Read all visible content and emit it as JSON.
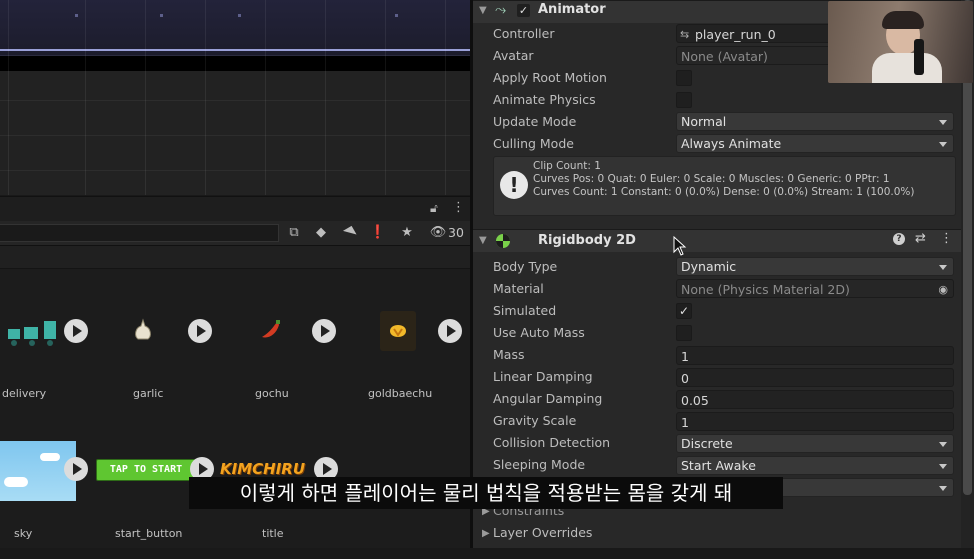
{
  "project": {
    "view_count": "30",
    "assets": [
      {
        "name": "delivery"
      },
      {
        "name": "garlic"
      },
      {
        "name": "gochu"
      },
      {
        "name": "goldbaechu"
      },
      {
        "name": "sky"
      },
      {
        "name": "start_button",
        "thumb_text": "TAP TO START"
      },
      {
        "name": "title",
        "thumb_text": "KIMCHIRU"
      }
    ]
  },
  "animator": {
    "title": "Animator",
    "enabled": true,
    "rows": {
      "controller_label": "Controller",
      "controller_value": "player_run_0",
      "avatar_label": "Avatar",
      "avatar_value": "None (Avatar)",
      "apply_root_motion_label": "Apply Root Motion",
      "animate_physics_label": "Animate Physics",
      "update_mode_label": "Update Mode",
      "update_mode_value": "Normal",
      "culling_mode_label": "Culling Mode",
      "culling_mode_value": "Always Animate"
    },
    "info": {
      "line1": "Clip Count: 1",
      "line2": "Curves Pos: 0 Quat: 0 Euler: 0 Scale: 0 Muscles: 0 Generic: 0 PPtr: 1",
      "line3": "Curves Count: 1 Constant: 0 (0.0%) Dense: 0 (0.0%) Stream: 1 (100.0%)"
    }
  },
  "rigidbody": {
    "title": "Rigidbody 2D",
    "rows": {
      "body_type_label": "Body Type",
      "body_type_value": "Dynamic",
      "material_label": "Material",
      "material_value": "None (Physics Material 2D)",
      "simulated_label": "Simulated",
      "use_auto_mass_label": "Use Auto Mass",
      "mass_label": "Mass",
      "mass_value": "1",
      "linear_damping_label": "Linear Damping",
      "linear_damping_value": "0",
      "angular_damping_label": "Angular Damping",
      "angular_damping_value": "0.05",
      "gravity_scale_label": "Gravity Scale",
      "gravity_scale_value": "1",
      "collision_detection_label": "Collision Detection",
      "collision_detection_value": "Discrete",
      "sleeping_mode_label": "Sleeping Mode",
      "sleeping_mode_value": "Start Awake",
      "constraints_label": "Constraints",
      "layer_overrides_label": "Layer Overrides"
    }
  },
  "subtitle": "이렇게 하면 플레이어는 물리 법칙을 적용받는 몸을 갖게 돼",
  "colors": {
    "panel": "#282828",
    "field": "#222222",
    "dropdown": "#383838",
    "rigidbody_icon": "#7ad14a"
  }
}
